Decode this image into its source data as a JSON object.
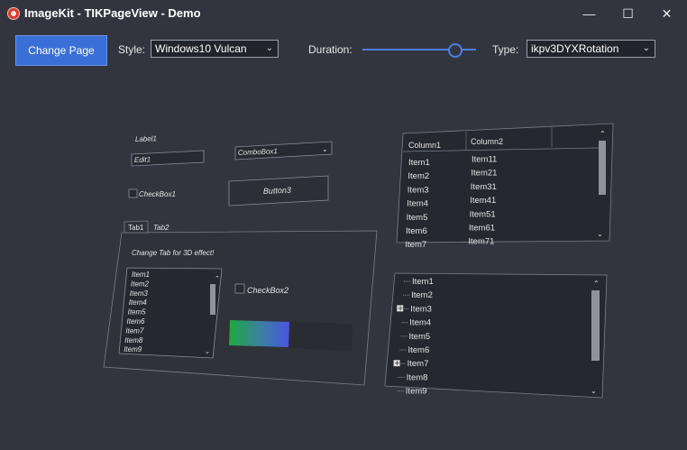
{
  "window": {
    "title": "ImageKit - TIKPageView - Demo",
    "min": "—",
    "max": "☐",
    "close": "✕"
  },
  "toolbar": {
    "change_page": "Change Page",
    "style_label": "Style:",
    "style_value": "Windows10 Vulcan",
    "duration_label": "Duration:",
    "duration_value": 0.8,
    "type_label": "Type:",
    "type_value": "ikpv3DYXRotation"
  },
  "page": {
    "label1": "Label1",
    "edit1": "Edit1",
    "combobox1": "ComboBox1",
    "checkbox1": "CheckBox1",
    "button3": "Button3",
    "tabs": [
      "Tab1",
      "Tab2"
    ],
    "tab_hint": "Change Tab for 3D effect!",
    "list_items": [
      "Item1",
      "Item2",
      "Item3",
      "Item4",
      "Item5",
      "Item6",
      "Item7",
      "Item8",
      "Item9"
    ],
    "checkbox2": "CheckBox2",
    "columns": [
      "Column1",
      "Column2"
    ],
    "grid_rows": [
      [
        "Item1",
        "Item11"
      ],
      [
        "Item2",
        "Item21"
      ],
      [
        "Item3",
        "Item31"
      ],
      [
        "Item4",
        "Item41"
      ],
      [
        "Item5",
        "Item51"
      ],
      [
        "Item6",
        "Item61"
      ],
      [
        "Item7",
        "Item71"
      ]
    ],
    "tree_items": [
      {
        "label": "Item1",
        "expandable": false
      },
      {
        "label": "Item2",
        "expandable": false
      },
      {
        "label": "Item3",
        "expandable": true
      },
      {
        "label": "Item4",
        "expandable": false
      },
      {
        "label": "Item5",
        "expandable": false
      },
      {
        "label": "Item6",
        "expandable": false
      },
      {
        "label": "Item7",
        "expandable": true
      },
      {
        "label": "Item8",
        "expandable": false
      },
      {
        "label": "Item9",
        "expandable": false
      }
    ]
  }
}
